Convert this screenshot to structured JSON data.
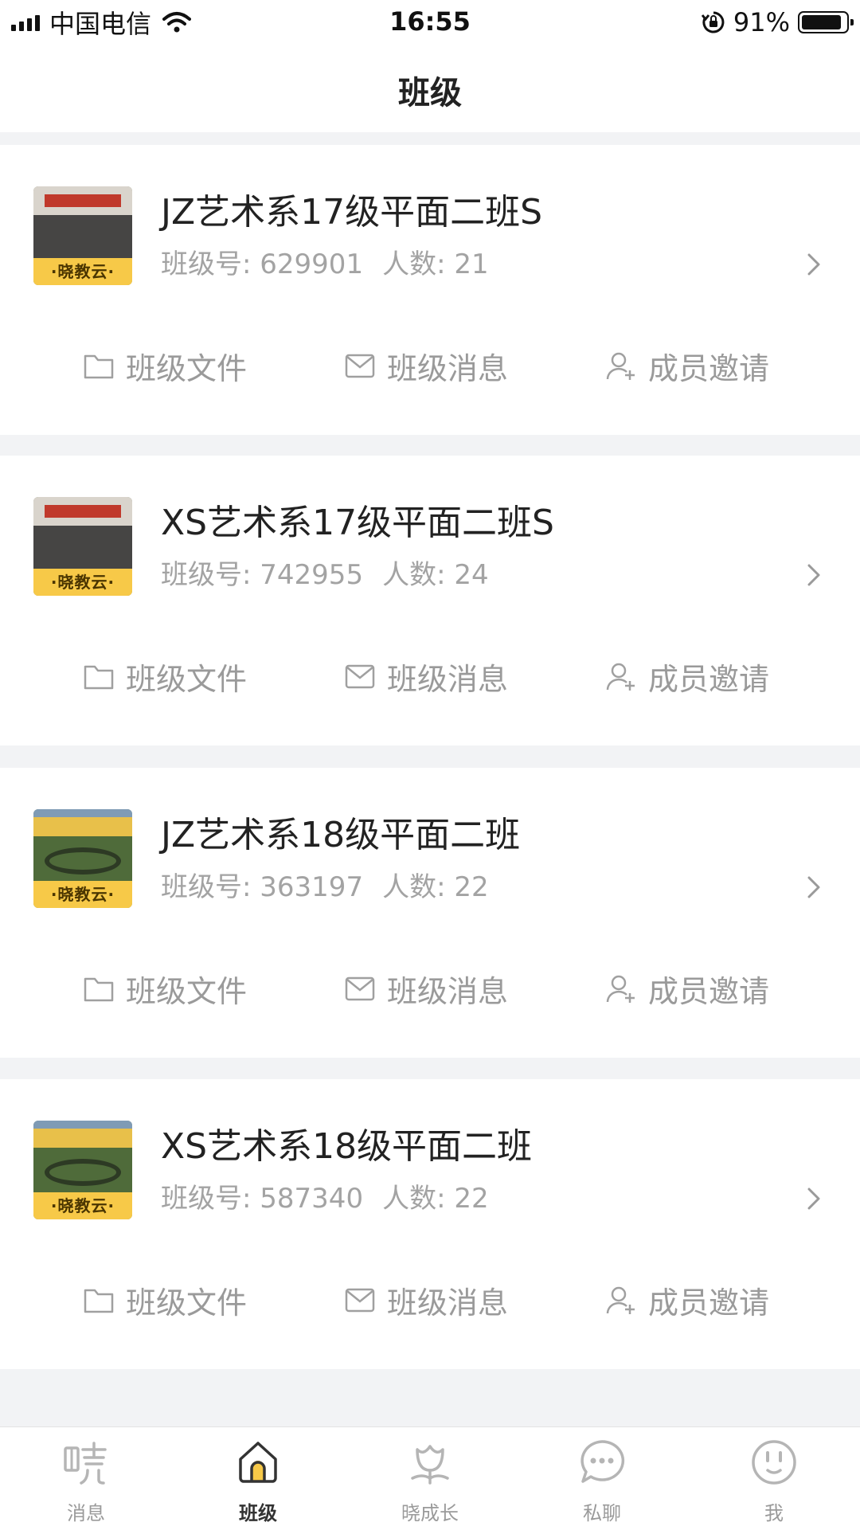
{
  "status_bar": {
    "carrier": "中国电信",
    "time": "16:55",
    "battery_percent_text": "91%",
    "battery_level": 0.91
  },
  "header": {
    "title": "班级"
  },
  "classes": [
    {
      "name": "JZ艺术系17级平面二班S",
      "class_no_label": "班级号:",
      "class_no": "629901",
      "count_label": "人数:",
      "count": "21",
      "thumb_badge": "·晓教云·",
      "thumb_type": "group-photo"
    },
    {
      "name": "XS艺术系17级平面二班S",
      "class_no_label": "班级号:",
      "class_no": "742955",
      "count_label": "人数:",
      "count": "24",
      "thumb_badge": "·晓教云·",
      "thumb_type": "group-photo"
    },
    {
      "name": "JZ艺术系18级平面二班",
      "class_no_label": "班级号:",
      "class_no": "363197",
      "count_label": "人数:",
      "count": "22",
      "thumb_badge": "·晓教云·",
      "thumb_type": "field-photo"
    },
    {
      "name": "XS艺术系18级平面二班",
      "class_no_label": "班级号:",
      "class_no": "587340",
      "count_label": "人数:",
      "count": "22",
      "thumb_badge": "·晓教云·",
      "thumb_type": "field-photo"
    }
  ],
  "card_actions": {
    "files": "班级文件",
    "messages": "班级消息",
    "invite": "成员邀请"
  },
  "tabs": [
    {
      "label": "消息",
      "icon": "xiao-logo-icon",
      "active": false
    },
    {
      "label": "班级",
      "icon": "home-icon",
      "active": true
    },
    {
      "label": "晓成长",
      "icon": "flower-icon",
      "active": false
    },
    {
      "label": "私聊",
      "icon": "chat-bubble-icon",
      "active": false
    },
    {
      "label": "我",
      "icon": "smiley-icon",
      "active": false
    }
  ],
  "colors": {
    "accent": "#f7c948",
    "background": "#f2f3f5",
    "muted_text": "#9a9a9a"
  }
}
